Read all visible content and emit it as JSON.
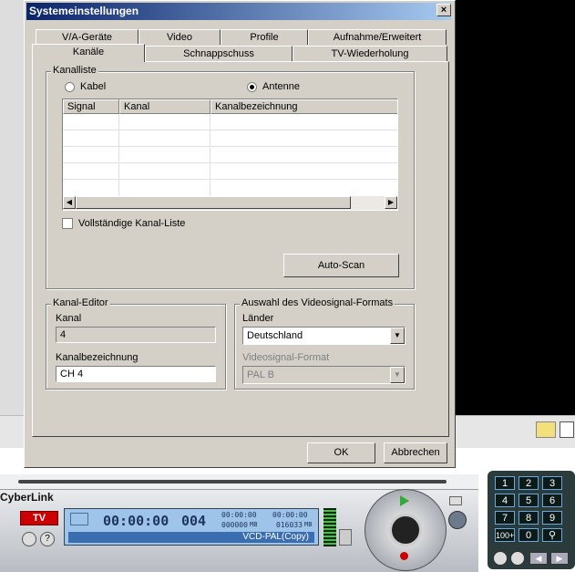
{
  "dialog": {
    "title": "Systemeinstellungen",
    "close_glyph": "×",
    "tabs_row1": [
      "V/A-Geräte",
      "Video",
      "Profile",
      "Aufnahme/Erweitert"
    ],
    "tabs_row2": [
      "Kanäle",
      "Schnappschuss",
      "TV-Wiederholung"
    ],
    "active_tab": "Kanäle"
  },
  "channel_list": {
    "group_title": "Kanalliste",
    "radio_cable": "Kabel",
    "radio_antenna": "Antenne",
    "selected": "Antenne",
    "columns": [
      "Signal",
      "Kanal",
      "Kanalbezeichnung"
    ],
    "rows": [],
    "full_list_checkbox": "Vollständige Kanal-Liste",
    "full_list_checked": false,
    "autoscan_label": "Auto-Scan"
  },
  "channel_editor": {
    "group_title": "Kanal-Editor",
    "channel_label": "Kanal",
    "channel_value": "4",
    "name_label": "Kanalbezeichnung",
    "name_value": "CH 4"
  },
  "video_format": {
    "group_title": "Auswahl des Videosignal-Formats",
    "country_label": "Länder",
    "country_value": "Deutschland",
    "format_label": "Videosignal-Format",
    "format_value": "PAL B"
  },
  "footer": {
    "ok_label": "OK",
    "cancel_label": "Abbrechen"
  },
  "player": {
    "brand": "CyberLink",
    "tv_label": "TV",
    "time": "00:00:00",
    "channel_number": "004",
    "rec_time": "00:00:00",
    "rec_time2": "00:00:00",
    "size1": "000000",
    "size2": "016033",
    "size_unit": "MB",
    "profile": "VCD-PAL(Copy)",
    "keypad": [
      "1",
      "2",
      "3",
      "4",
      "5",
      "6",
      "7",
      "8",
      "9",
      "100+",
      "0"
    ]
  },
  "colors": {
    "dialog_bg": "#d4d0c8",
    "title_start": "#0a246a",
    "title_end": "#a6caf0",
    "lcd_bg": "#9ec4ea"
  }
}
